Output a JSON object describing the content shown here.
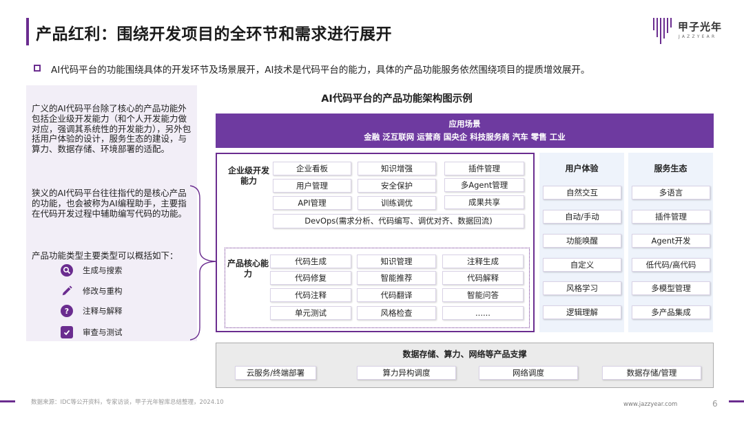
{
  "header": {
    "title": "产品红利：围绕开发项目的全环节和需求进行展开",
    "logo_cn": "甲子光年",
    "logo_en": "JAZZYEAR"
  },
  "lead": "AI代码平台的功能围绕具体的开发环节及场景展开，AI技术是代码平台的能力，具体的产品功能服务依然围绕项目的提质增效展开。",
  "left_panel": {
    "p1": "广义的AI代码平台除了核心的产品功能外包括企业级开发能力（和个人开发能力做对应，强调其系统性的开发能力），另外包括用户体验的设计，服务生态的建设，与算力、数据存储、环境部署的适配。",
    "p2": "狭义的AI代码平台往往指代的是核心产品的功能，也会被称为AI编程助手，主要指在代码开发过程中辅助编写代码的功能。",
    "p3": "产品功能类型主要类型可以概括如下：",
    "types": [
      {
        "label": "生成与搜索",
        "icon": "search-icon"
      },
      {
        "label": "修改与重构",
        "icon": "pencil-icon"
      },
      {
        "label": "注释与解释",
        "icon": "question-icon"
      },
      {
        "label": "审查与测试",
        "icon": "checklist-icon"
      }
    ]
  },
  "diagram": {
    "title": "AI代码平台的产品功能架构图示例",
    "app": {
      "title": "应用场景",
      "items": "金融 泛互联网  运营商  国央企 科技服务商 汽车 零售 工业"
    },
    "enterprise": {
      "label": "企业级开发能力",
      "cells": [
        "企业看板",
        "知识增强",
        "插件管理",
        "用户管理",
        "安全保护",
        "多Agent管理",
        "API管理",
        "训练调优",
        "成果共享",
        "DevOps(需求分析、代码编写、调优对齐、数据回流)"
      ]
    },
    "core": {
      "label": "产品核心能力",
      "cells": [
        "代码生成",
        "知识管理",
        "注释生成",
        "代码修复",
        "智能推荐",
        "代码解释",
        "代码注释",
        "代码翻译",
        "智能问答",
        "单元测试",
        "风格检查",
        "......"
      ]
    },
    "ux": {
      "title": "用户体验",
      "items": [
        "自然交互",
        "自动/手动",
        "功能唤醒",
        "自定义",
        "风格学习",
        "逻辑理解"
      ]
    },
    "eco": {
      "title": "服务生态",
      "items": [
        "多语言",
        "插件管理",
        "Agent开发",
        "低代码/高代码",
        "多模型管理",
        "多产品集成"
      ]
    },
    "infra": {
      "title": "数据存储、算力、网络等产品支撑",
      "items": [
        "云服务/终端部署",
        "算力异构调度",
        "网络调度",
        "数据存储/管理"
      ]
    }
  },
  "footer": {
    "source": "数据来源：IDC等公开资料，专家访谈，甲子光年智库总结整理，2024.10",
    "url": "www.jazzyear.com",
    "page": "6"
  },
  "colors": {
    "accent": "#6a2c8f",
    "app_bar": "#6e3aa0",
    "left_panel": "#f2eef7",
    "side_col": "#eef3fb",
    "infra_bg": "#ebebeb"
  }
}
